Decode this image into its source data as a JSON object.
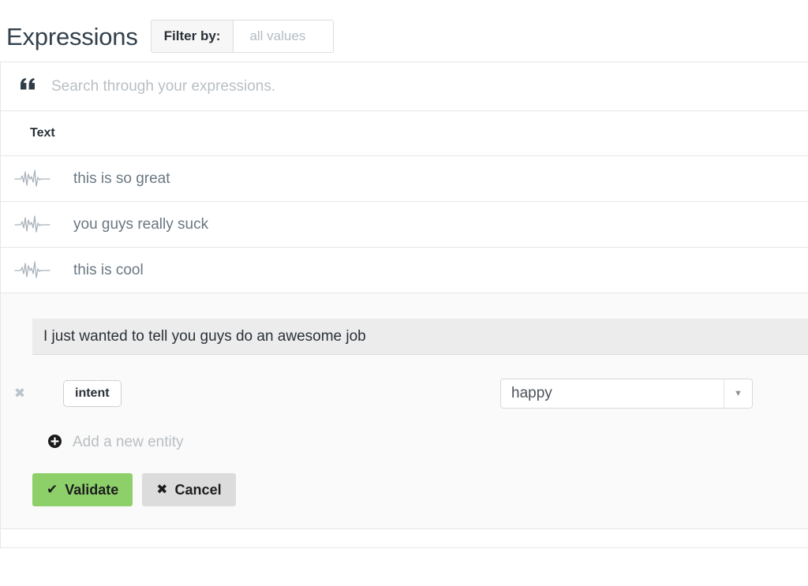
{
  "header": {
    "title": "Expressions",
    "filter": {
      "label": "Filter by:",
      "value_placeholder": "all values",
      "value": ""
    }
  },
  "search": {
    "icon": "quote-left-icon",
    "placeholder": "Search through your expressions.",
    "value": ""
  },
  "table": {
    "columns": [
      "Text"
    ],
    "rows": [
      {
        "icon": "waveform-icon",
        "text": "this is so great"
      },
      {
        "icon": "waveform-icon",
        "text": "you guys really suck"
      },
      {
        "icon": "waveform-icon",
        "text": "this is cool"
      }
    ]
  },
  "editor": {
    "sentence": "I just wanted to tell you guys do an awesome job",
    "entity": {
      "remove_glyph": "✖",
      "tag_label": "intent",
      "select_value": "happy",
      "select_arrow": "▼"
    },
    "add_entity": {
      "glyph": "⊕",
      "label": "Add a new entity"
    },
    "buttons": {
      "validate": {
        "glyph": "✔",
        "label": "Validate"
      },
      "cancel": {
        "glyph": "✖",
        "label": "Cancel"
      }
    }
  },
  "colors": {
    "title": "#33414d",
    "validate_green": "#8dd06a",
    "cancel_gray": "#dcdcdc",
    "muted_text": "#b9bfc4",
    "row_text": "#6a7782",
    "border": "#e4e7ea"
  }
}
